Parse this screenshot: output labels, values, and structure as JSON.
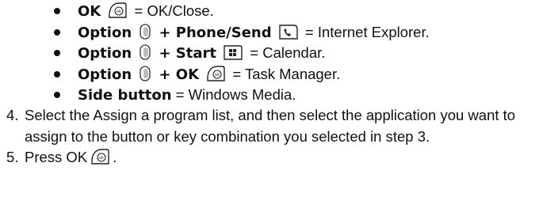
{
  "bullets": [
    {
      "bold": "OK",
      "key1": "ok-key-icon",
      "text": " = OK/Close."
    },
    {
      "bold": "Option",
      "key1": "option-key-icon",
      "bold2": " + Phone/Send",
      "key2": "phone-send-key-icon",
      "text": " = Internet Explorer."
    },
    {
      "bold": "Option",
      "key1": "option-key-icon",
      "bold2": " + Start",
      "key2": "start-key-icon",
      "text": " = Calendar."
    },
    {
      "bold": "Option",
      "key1": "option-key-icon",
      "bold2": " + OK",
      "key2": "ok-key-icon",
      "text": " = Task Manager."
    },
    {
      "bold": "Side button",
      "text": " = Windows Media."
    }
  ],
  "steps": [
    {
      "number": "4.",
      "text": "Select the Assign a program list, and then select the application you want to assign to the button or key combination you selected in step 3."
    },
    {
      "number": "5.",
      "text": "Press OK",
      "text_end": ".",
      "key": "ok-key-icon"
    }
  ]
}
